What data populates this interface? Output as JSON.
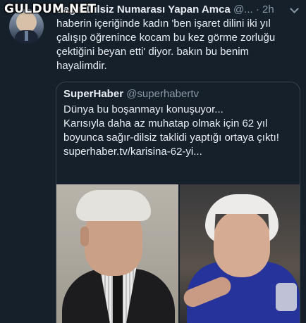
{
  "watermark": "GULDUM.NET",
  "tweet": {
    "author_name": "Sağır-Dilsiz Numarası Yapan Amca",
    "handle": "@...",
    "separator": "·",
    "time": "2h",
    "text": "haberin içeriğinde kadın 'ben işaret dilini iki yıl çalışıp öğrenince kocam bu kez görme zorluğu çektiğini beyan etti' diyor. bakın bu benim hayalimdir."
  },
  "quoted": {
    "name": "SuperHaber",
    "handle": "@superhabertv",
    "lines": [
      "Dünya bu boşanmayı konuşuyor...",
      "Karısıyla daha az muhatap olmak için 62 yıl boyunca sağır-dilsiz taklidi yaptığı ortaya çıktı!",
      "superhaber.tv/karisina-62-yi..."
    ]
  },
  "colors": {
    "background": "#15202b",
    "text": "#e8edf2",
    "muted": "#8899a6",
    "border": "#38444d"
  }
}
